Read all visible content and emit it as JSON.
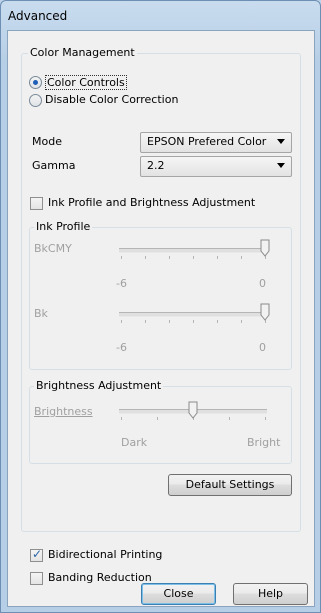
{
  "window": {
    "title": "Advanced"
  },
  "color_management": {
    "label": "Color Management",
    "radio_color_controls": "Color Controls",
    "radio_disable": "Disable Color Correction",
    "mode_label": "Mode",
    "mode_value": "EPSON Prefered Color",
    "gamma_label": "Gamma",
    "gamma_value": "2.2",
    "ink_profile_check_label": "Ink Profile and Brightness Adjustment"
  },
  "ink_profile": {
    "label": "Ink Profile",
    "bkcmy_label": "BkCMY",
    "bkcmy_min": "-6",
    "bkcmy_max": "0",
    "bkcmy_value": 0,
    "bk_label": "Bk",
    "bk_min": "-6",
    "bk_max": "0",
    "bk_value": 0
  },
  "brightness": {
    "label": "Brightness Adjustment",
    "slider_label": "Brightness",
    "min_label": "Dark",
    "max_label": "Bright",
    "value_fraction": 0.5
  },
  "buttons": {
    "default_settings": "Default Settings",
    "close": "Close",
    "help": "Help"
  },
  "options": {
    "bidirectional": "Bidirectional Printing",
    "bidirectional_checked": true,
    "banding": "Banding Reduction",
    "banding_checked": false
  }
}
